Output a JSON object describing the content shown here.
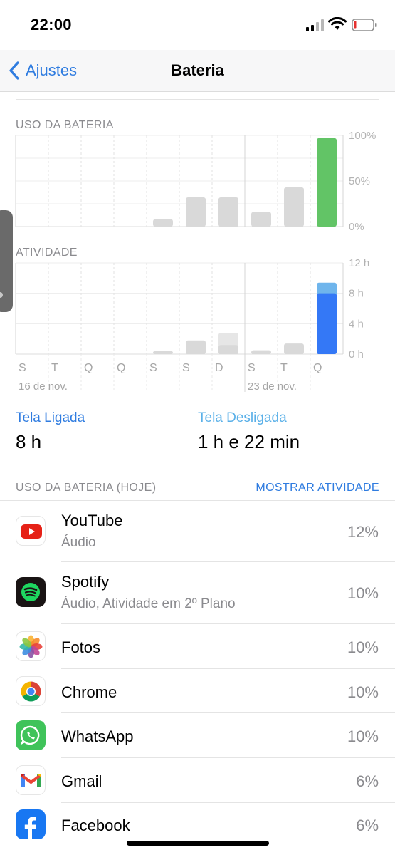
{
  "status": {
    "time": "22:00"
  },
  "nav": {
    "back_label": "Ajustes",
    "title": "Bateria"
  },
  "battery_chart": {
    "label": "USO DA BATERIA",
    "y_ticks": [
      "100%",
      "50%",
      "0%"
    ]
  },
  "activity_chart": {
    "label": "ATIVIDADE",
    "y_ticks": [
      "12 h",
      "8 h",
      "4 h",
      "0 h"
    ]
  },
  "x_axis": {
    "days": [
      "S",
      "T",
      "Q",
      "Q",
      "S",
      "S",
      "D",
      "S",
      "T",
      "Q"
    ],
    "date_labels": [
      "16 de nov.",
      "23 de nov."
    ]
  },
  "chart_data": [
    {
      "type": "bar",
      "title": "USO DA BATERIA",
      "categories": [
        "S",
        "T",
        "Q",
        "Q",
        "S",
        "S",
        "D",
        "S",
        "T",
        "Q"
      ],
      "values": [
        0,
        0,
        0,
        0,
        8,
        32,
        32,
        16,
        43,
        97
      ],
      "ylim": [
        0,
        100
      ],
      "grid": true
    },
    {
      "type": "bar",
      "title": "ATIVIDADE",
      "categories": [
        "S",
        "T",
        "Q",
        "Q",
        "S",
        "S",
        "D",
        "S",
        "T",
        "Q"
      ],
      "series": [
        {
          "values": [
            0,
            0,
            0,
            0,
            0.4,
            1.8,
            1.2,
            0.5,
            1.4,
            8
          ]
        },
        {
          "values": [
            0,
            0,
            0,
            0,
            0,
            0,
            1.6,
            0,
            0,
            1.4
          ]
        }
      ],
      "ylim": [
        0,
        12
      ],
      "grid": true
    }
  ],
  "stats": {
    "screen_on_label": "Tela Ligada",
    "screen_on_value": "8 h",
    "screen_off_label": "Tela Desligada",
    "screen_off_value": "1 h e 22 min"
  },
  "usage": {
    "label": "USO DA BATERIA (HOJE)",
    "show_activity": "MOSTRAR ATIVIDADE",
    "apps": [
      {
        "name": "YouTube",
        "sub": "Áudio",
        "pct": "12%",
        "icon": "youtube-icon"
      },
      {
        "name": "Spotify",
        "sub": "Áudio, Atividade em 2º Plano",
        "pct": "10%",
        "icon": "spotify-icon"
      },
      {
        "name": "Fotos",
        "sub": "",
        "pct": "10%",
        "icon": "photos-icon"
      },
      {
        "name": "Chrome",
        "sub": "",
        "pct": "10%",
        "icon": "chrome-icon"
      },
      {
        "name": "WhatsApp",
        "sub": "",
        "pct": "10%",
        "icon": "whatsapp-icon"
      },
      {
        "name": "Gmail",
        "sub": "",
        "pct": "6%",
        "icon": "gmail-icon"
      },
      {
        "name": "Facebook",
        "sub": "",
        "pct": "6%",
        "icon": "facebook-icon"
      }
    ]
  },
  "colors": {
    "accent": "#2f7ce0",
    "battery_bar_today": "#62c466",
    "bar_gray": "#d9d9d9",
    "bar_gray_light": "#e6e6e6",
    "activity_screen_on": "#3478f6",
    "activity_screen_off": "#6fb5ec",
    "screen_off_label": "#5ab0e8"
  }
}
